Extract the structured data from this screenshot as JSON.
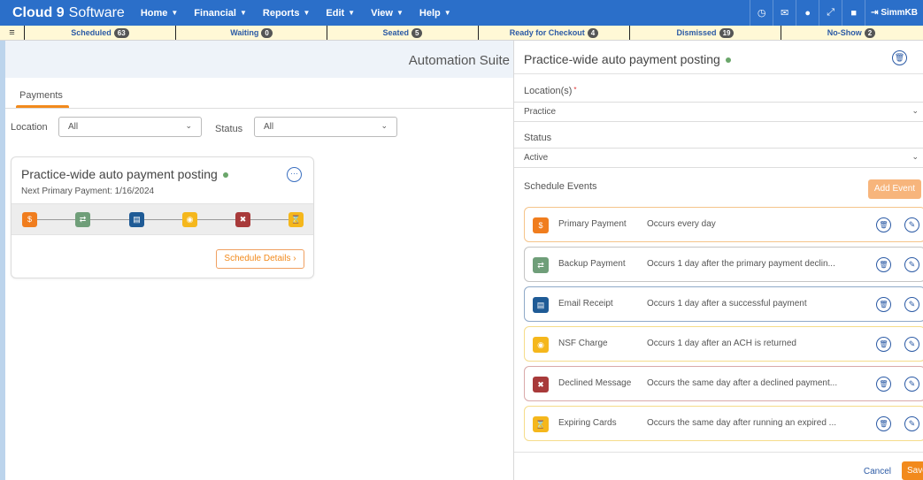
{
  "nav": {
    "brand_bold": "Cloud 9",
    "brand_rest": "Software",
    "menu": [
      {
        "label": "Home"
      },
      {
        "label": "Financial"
      },
      {
        "label": "Reports"
      },
      {
        "label": "Edit"
      },
      {
        "label": "View"
      },
      {
        "label": "Help"
      }
    ],
    "icons": [
      "clock-icon",
      "mail-icon",
      "chat-icon",
      "expand-icon",
      "lock-icon"
    ],
    "user": "SimmKB"
  },
  "status_tabs": [
    {
      "label": "Scheduled",
      "count": "63"
    },
    {
      "label": "Waiting",
      "count": "0"
    },
    {
      "label": "Seated",
      "count": "5"
    },
    {
      "label": "Ready for Checkout",
      "count": "4"
    },
    {
      "label": "Dismissed",
      "count": "19"
    },
    {
      "label": "No-Show",
      "count": "2"
    }
  ],
  "left": {
    "suite_title": "Automation Suite",
    "tab": "Payments",
    "location_label": "Location",
    "location_value": "All",
    "status_label": "Status",
    "status_value": "All",
    "card": {
      "title": "Practice-wide auto payment posting",
      "subtitle": "Next Primary Payment: 1/16/2024",
      "schedule_button": "Schedule Details"
    }
  },
  "right": {
    "title": "Practice-wide auto payment posting",
    "location_label": "Location(s)",
    "location_value": "Practice",
    "status_label": "Status",
    "status_value": "Active",
    "events_label": "Schedule Events",
    "add_event": "Add Event",
    "events": [
      {
        "name": "Primary Payment",
        "desc": "Occurs every day",
        "color": "#f07d1e",
        "border": "#f5c48a",
        "icon": "dollar-icon",
        "glyph": "$"
      },
      {
        "name": "Backup Payment",
        "desc": "Occurs 1 day after the primary payment declin...",
        "color": "#6f9e79",
        "border": "#c4c4c4",
        "icon": "repeat-icon",
        "glyph": "⇄"
      },
      {
        "name": "Email Receipt",
        "desc": "Occurs 1 day after a successful payment",
        "color": "#1f5b96",
        "border": "#8fa9c8",
        "icon": "document-icon",
        "glyph": "▤"
      },
      {
        "name": "NSF Charge",
        "desc": "Occurs 1 day after an ACH is returned",
        "color": "#f5b71c",
        "border": "#f5dc8a",
        "icon": "coin-icon",
        "glyph": "◉"
      },
      {
        "name": "Declined Message",
        "desc": "Occurs the same day after a declined payment...",
        "color": "#a83a3a",
        "border": "#d9a9a9",
        "icon": "declined-icon",
        "glyph": "✖"
      },
      {
        "name": "Expiring Cards",
        "desc": "Occurs the same day after running an expired ...",
        "color": "#f5b71c",
        "border": "#f5dc8a",
        "icon": "hourglass-icon",
        "glyph": "⌛"
      }
    ],
    "cancel": "Cancel",
    "save": "Save"
  }
}
